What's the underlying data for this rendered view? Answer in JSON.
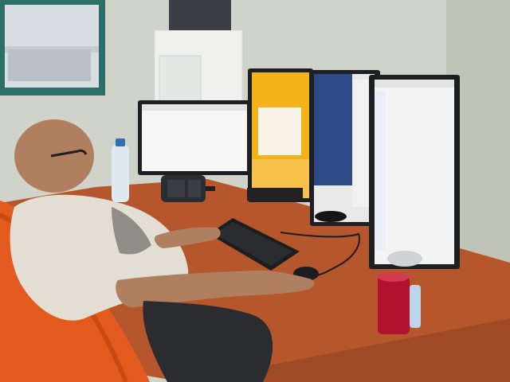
{
  "scene": {
    "palette": {
      "wall": "#cfd3c9",
      "desk": "#b5562c",
      "chair": "#e35a1f",
      "monitor_frame": "#1d1f22",
      "win8_screen": "#f3b21a",
      "blue_screen": "#2e4a86",
      "shirt": "#e3ded3",
      "skin": "#b07f5f"
    },
    "objects": [
      "window-frame",
      "white-cabinet",
      "desk",
      "office-chair",
      "person",
      "left-monitor",
      "win8-monitor",
      "blue-ide-monitor",
      "right-monitor",
      "desk-phone",
      "water-bottle",
      "keyboard",
      "mouse",
      "red-can",
      "cable"
    ]
  }
}
